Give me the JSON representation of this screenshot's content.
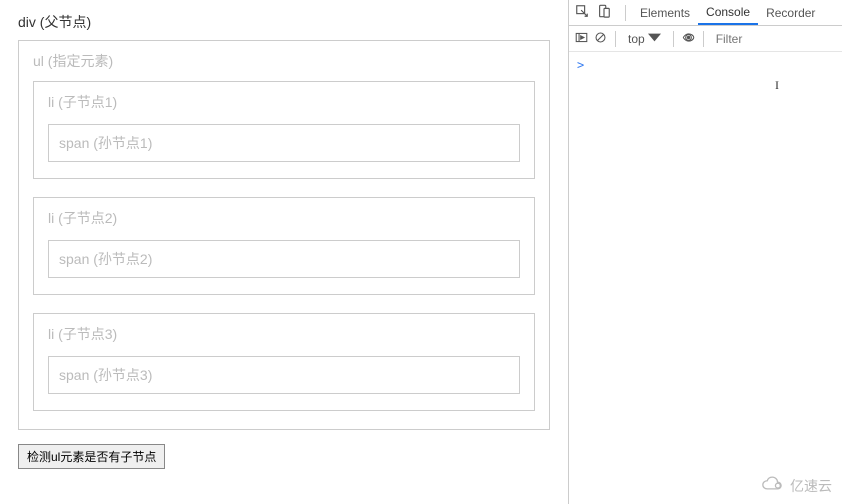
{
  "left": {
    "parent_label": "div (父节点)",
    "ul_label": "ul (指定元素)",
    "items": [
      {
        "li_label": "li (子节点1)",
        "span_label": "span (孙节点1)"
      },
      {
        "li_label": "li (子节点2)",
        "span_label": "span (孙节点2)"
      },
      {
        "li_label": "li (子节点3)",
        "span_label": "span (孙节点3)"
      }
    ],
    "button_label": "检测ul元素是否有子节点"
  },
  "devtools": {
    "tabs": {
      "elements": "Elements",
      "console": "Console",
      "recorder": "Recorder"
    },
    "toolbar": {
      "top_label": "top",
      "filter_placeholder": "Filter"
    },
    "prompt": ">"
  },
  "watermark": "亿速云"
}
